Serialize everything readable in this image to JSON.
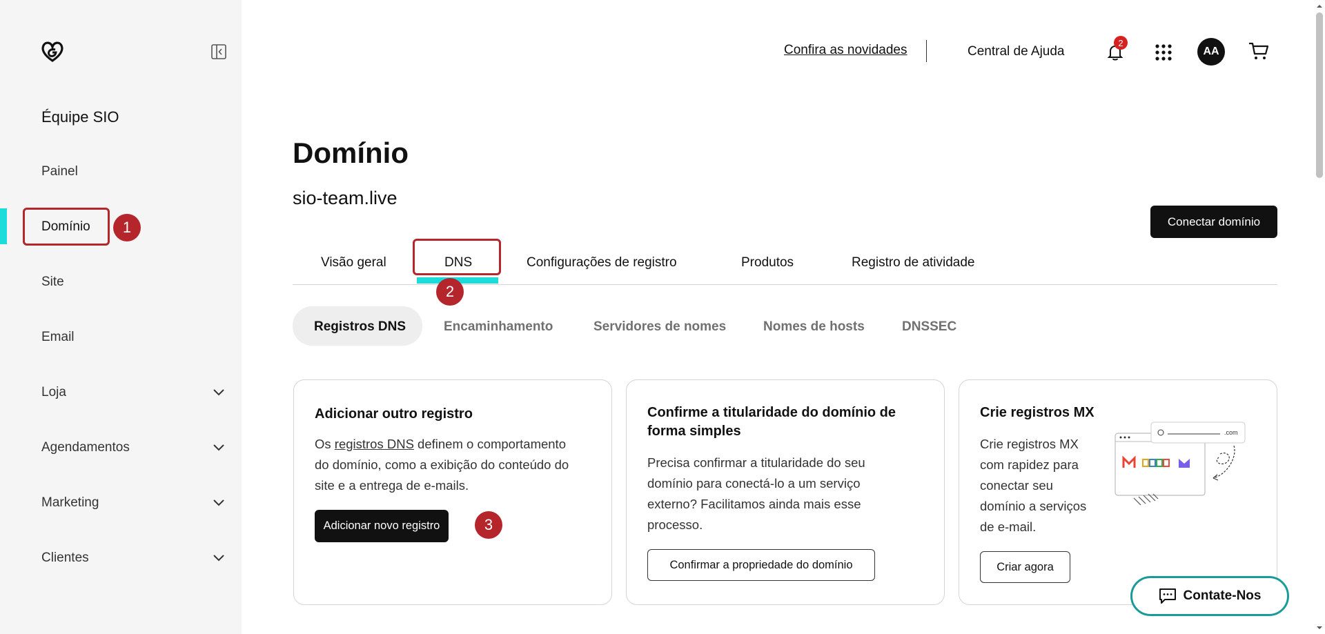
{
  "sidebar": {
    "team_name": "Équipe SIO",
    "items": [
      {
        "label": "Painel"
      },
      {
        "label": "Domínio"
      },
      {
        "label": "Site"
      },
      {
        "label": "Email"
      },
      {
        "label": "Loja"
      },
      {
        "label": "Agendamentos"
      },
      {
        "label": "Marketing"
      },
      {
        "label": "Clientes"
      }
    ]
  },
  "header": {
    "news_link": "Confira as novidades",
    "help_link": "Central de Ajuda",
    "notification_count": "2",
    "avatar_initials": "AA"
  },
  "main": {
    "title": "Domínio",
    "domain": "sio-team.live",
    "connect_button": "Conectar domínio",
    "tabs": [
      {
        "label": "Visão geral"
      },
      {
        "label": "DNS"
      },
      {
        "label": "Configurações de registro"
      },
      {
        "label": "Produtos"
      },
      {
        "label": "Registro de atividade"
      }
    ],
    "subtabs": [
      {
        "label": "Registros DNS"
      },
      {
        "label": "Encaminhamento"
      },
      {
        "label": "Servidores de nomes"
      },
      {
        "label": "Nomes de hosts"
      },
      {
        "label": "DNSSEC"
      }
    ],
    "cards": [
      {
        "title": "Adicionar outro registro",
        "text_before": "Os ",
        "link": "registros DNS",
        "text_line1_after": " definem o comportamento",
        "text_line2": "do domínio, como a exibição do conteúdo do",
        "text_line3": "site e a entrega de e-mails.",
        "button": "Adicionar novo registro"
      },
      {
        "title_line1": "Confirme a titularidade do domínio de",
        "title_line2": "forma simples",
        "text_line1": "Precisa confirmar a titularidade do seu",
        "text_line2": "domínio para conectá-lo a um serviço",
        "text_line3": "externo? Facilitamos ainda mais esse",
        "text_line4": "processo.",
        "button": "Confirmar a propriedade do domínio"
      },
      {
        "title": "Crie registros MX",
        "text_line1": "Crie registros MX",
        "text_line2": "com rapidez para",
        "text_line3": "conectar seu",
        "text_line4": "domínio a serviços",
        "text_line5": "de e-mail.",
        "button": "Criar agora",
        "illustration_domain": ".com"
      }
    ]
  },
  "annotations": [
    "1",
    "2",
    "3"
  ],
  "contact_button": "Contate-Nos",
  "colors": {
    "accent": "#1bdbdb",
    "annotation": "#b5262c",
    "badge": "#d5211f",
    "contact_border": "#1b9a9a"
  }
}
